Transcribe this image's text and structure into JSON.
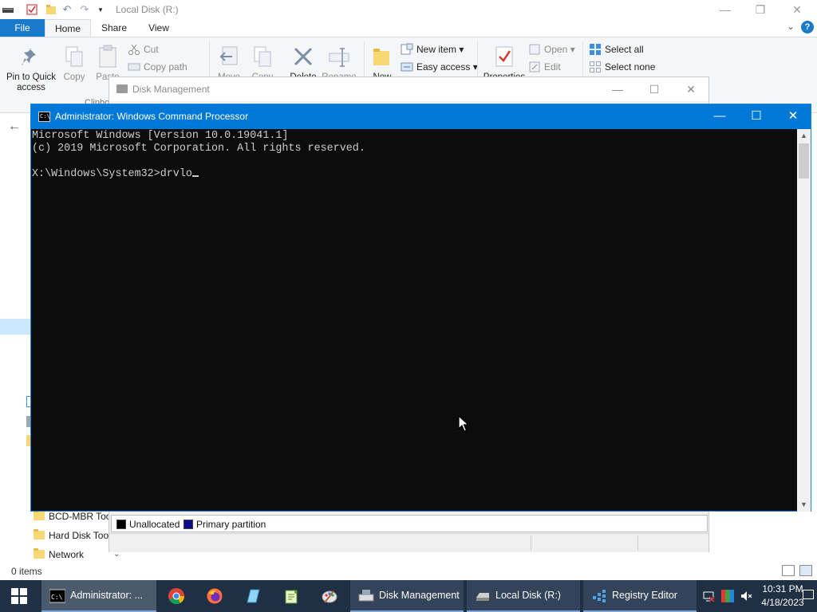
{
  "explorer": {
    "title": "Local Disk (R:)",
    "tabs": {
      "file": "File",
      "home": "Home",
      "share": "Share",
      "view": "View"
    },
    "ribbon": {
      "pin": "Pin to Quick access",
      "copy": "Copy",
      "paste": "Paste",
      "cut": "Cut",
      "copy_path": "Copy path",
      "clipboard": "Clipbo",
      "move": "Move",
      "copy_to": "Copy",
      "delete": "Delete",
      "rename": "Rename",
      "new": "New",
      "new_item": "New item ▾",
      "easy_access": "Easy access ▾",
      "properties": "Properties",
      "open": "Open ▾",
      "edit": "Edit",
      "select_all": "Select all",
      "select_none": "Select none"
    },
    "sidebar": [
      {
        "label": "BCD-MBR Tool"
      },
      {
        "label": "Hard Disk Tool"
      },
      {
        "label": "Network"
      }
    ],
    "status": "0 items"
  },
  "disk_management": {
    "title": "Disk Management",
    "legend": [
      {
        "label": "Unallocated",
        "color": "#000000"
      },
      {
        "label": "Primary partition",
        "color": "#0a0a8c"
      }
    ]
  },
  "cmd": {
    "title": "Administrator: Windows Command Processor",
    "lines": [
      "Microsoft Windows [Version 10.0.19041.1]",
      "(c) 2019 Microsoft Corporation. All rights reserved.",
      "",
      "X:\\Windows\\System32>drvlo"
    ]
  },
  "taskbar": {
    "apps": [
      {
        "label": "Administrator: ...",
        "icon": "cmd-icon"
      },
      {
        "label": "Disk Management",
        "icon": "disk-management-icon"
      },
      {
        "label": "Local Disk (R:)",
        "icon": "drive-icon"
      },
      {
        "label": "Registry Editor",
        "icon": "registry-icon"
      }
    ],
    "pins": [
      "chrome-icon",
      "firefox-icon",
      "notepad-icon",
      "notepad-plus-icon",
      "paint-icon"
    ],
    "clock": {
      "time": "10:31 PM",
      "date": "4/18/2023"
    }
  }
}
